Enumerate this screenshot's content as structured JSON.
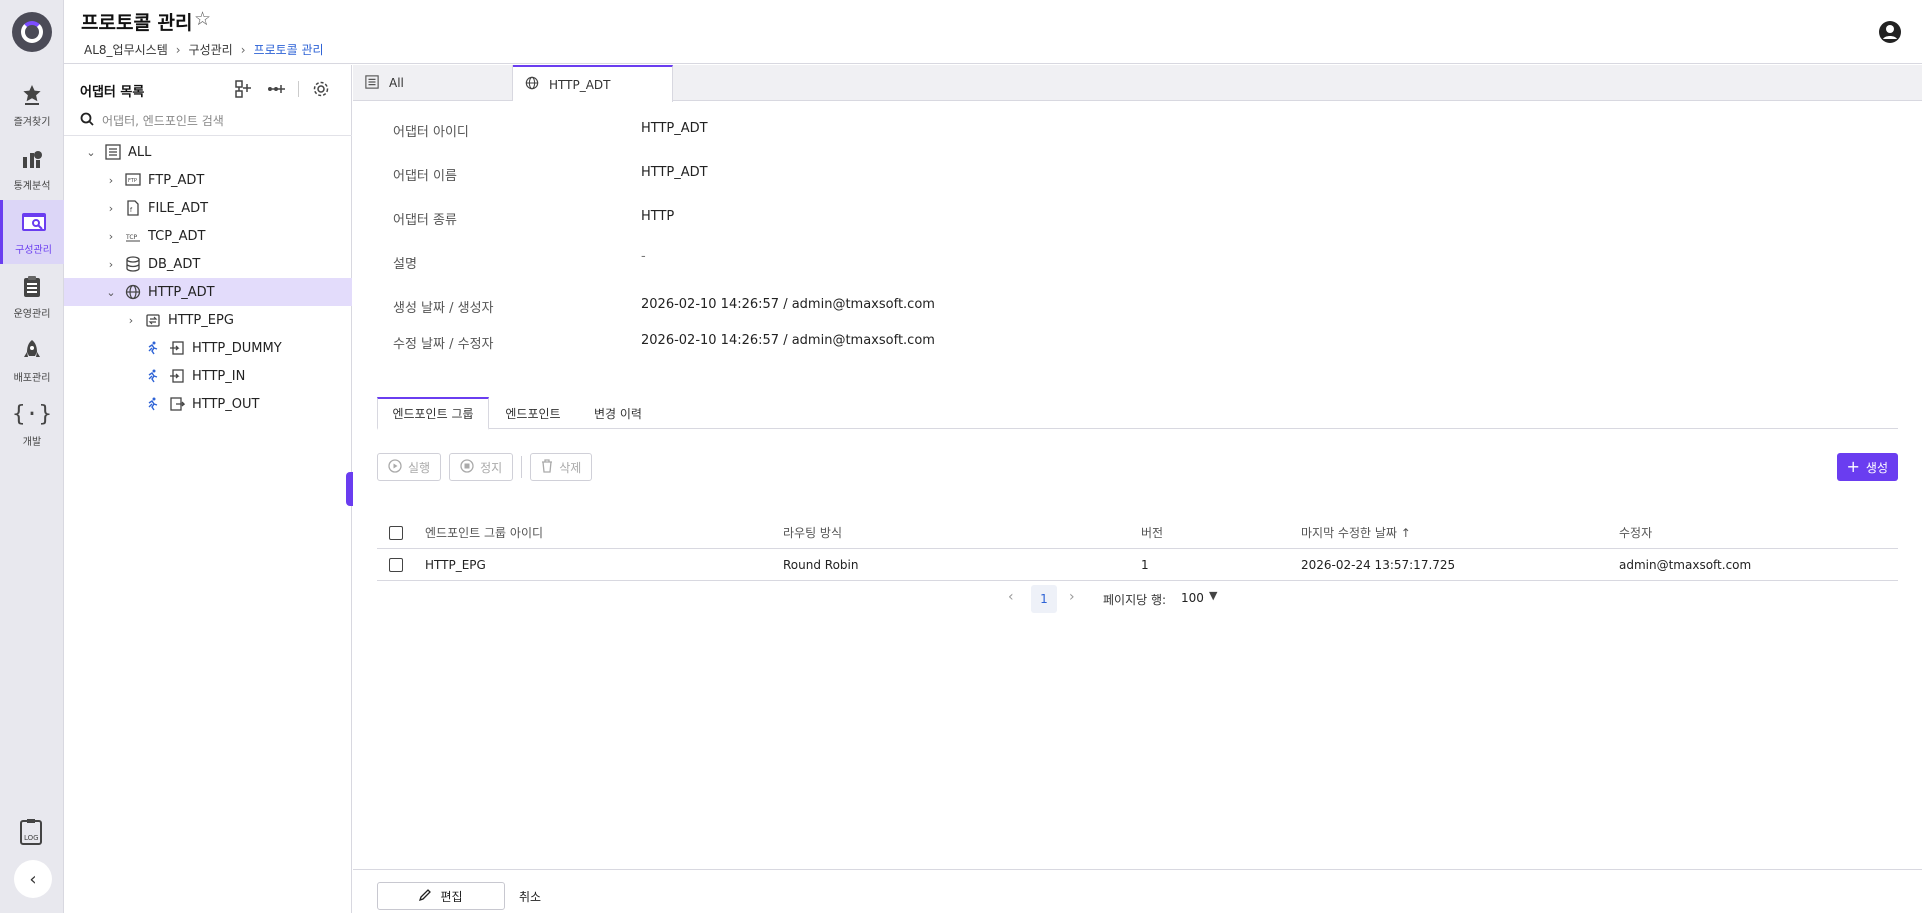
{
  "header": {
    "title": "프로토콜 관리",
    "breadcrumb": [
      "AL8_업무시스템",
      "구성관리",
      "프로토콜 관리"
    ]
  },
  "rail": {
    "items": [
      {
        "label": "즐겨찾기",
        "icon": "star-icon"
      },
      {
        "label": "통계분석",
        "icon": "chart-icon"
      },
      {
        "label": "구성관리",
        "icon": "config-icon",
        "active": true
      },
      {
        "label": "운영관리",
        "icon": "clipboard-icon"
      },
      {
        "label": "배포관리",
        "icon": "rocket-icon"
      },
      {
        "label": "개발",
        "icon": "code-icon"
      }
    ]
  },
  "tree": {
    "title": "어댑터 목록",
    "search_placeholder": "어댑터, 엔드포인트 검색",
    "nodes": [
      {
        "label": "ALL",
        "icon": "list-icon",
        "expanded": true
      },
      {
        "label": "FTP_ADT",
        "icon": "ftp-icon"
      },
      {
        "label": "FILE_ADT",
        "icon": "file-icon"
      },
      {
        "label": "TCP_ADT",
        "icon": "tcp-icon"
      },
      {
        "label": "DB_ADT",
        "icon": "database-icon"
      },
      {
        "label": "HTTP_ADT",
        "icon": "globe-icon",
        "selected": true,
        "expanded": true
      },
      {
        "label": "HTTP_EPG",
        "icon": "endpoint-group-icon"
      },
      {
        "label": "HTTP_DUMMY",
        "icon": "endpoint-icon"
      },
      {
        "label": "HTTP_IN",
        "icon": "endpoint-in-icon"
      },
      {
        "label": "HTTP_OUT",
        "icon": "endpoint-out-icon"
      }
    ]
  },
  "doc_tabs": [
    {
      "label": "All",
      "icon": "list-icon"
    },
    {
      "label": "HTTP_ADT",
      "icon": "globe-icon",
      "active": true
    }
  ],
  "info": [
    {
      "key": "어댑터 아이디",
      "value": "HTTP_ADT"
    },
    {
      "key": "어댑터 이름",
      "value": "HTTP_ADT"
    },
    {
      "key": "어댑터 종류",
      "value": "HTTP"
    },
    {
      "key": "설명",
      "value": "-"
    },
    {
      "key": "생성 날짜 / 생성자",
      "value": "2026-02-10 14:26:57 / admin@tmaxsoft.com"
    },
    {
      "key": "수정 날짜 / 수정자",
      "value": "2026-02-10 14:26:57 / admin@tmaxsoft.com"
    }
  ],
  "sub_tabs": [
    "엔드포인트 그룹",
    "엔드포인트",
    "변경 이력"
  ],
  "toolbar": {
    "run": "실행",
    "stop": "정지",
    "delete": "삭제",
    "create": "생성"
  },
  "table": {
    "columns": [
      "엔드포인트 그룹 아이디",
      "라우팅 방식",
      "버전",
      "마지막 수정한 날짜 ↑",
      "수정자"
    ],
    "rows": [
      [
        "HTTP_EPG",
        "Round Robin",
        "1",
        "2026-02-24 13:57:17.725",
        "admin@tmaxsoft.com"
      ]
    ]
  },
  "pager": {
    "current": "1",
    "rows_per_page_label": "페이지당 행:",
    "rows_per_page": "100"
  },
  "footer": {
    "edit": "편집",
    "cancel": "취소"
  },
  "colors": {
    "accent": "#6a3df0",
    "link": "#2e63d6"
  }
}
